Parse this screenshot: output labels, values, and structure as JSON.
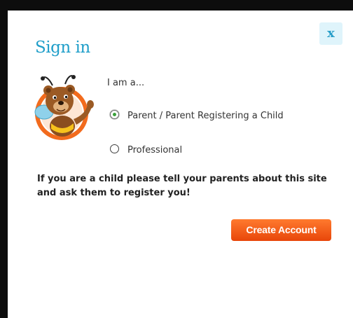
{
  "dialog": {
    "title": "Sign in",
    "close_label": "x",
    "prompt": "I am a...",
    "options": [
      {
        "label": "Parent / Parent Registering a Child",
        "selected": true
      },
      {
        "label": "Professional",
        "selected": false
      }
    ],
    "notice": "If you are a child please tell your parents about this site and ask them to register you!",
    "create_account_label": "Create Account"
  },
  "colors": {
    "title": "#1f9ec9",
    "button": "#f0560f",
    "close_bg": "#dff4fb"
  },
  "icons": {
    "mascot": "bee-bear-mascot-icon"
  }
}
